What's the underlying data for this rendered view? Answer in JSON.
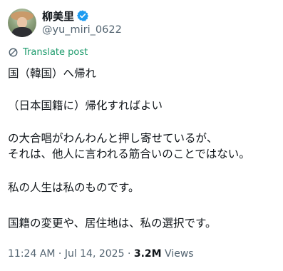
{
  "author": {
    "display_name": "柳美里",
    "handle": "@yu_miri_0622"
  },
  "translate_label": "Translate post",
  "post_lines": [
    "国（韓国）へ帰れ",
    "（日本国籍に）帰化すればよい",
    "の大合唱がわんわんと押し寄せているが、",
    "それは、他人に言われる筋合いのことではない。",
    "私の人生は私のものです。",
    "国籍の変更や、居住地は、私の選択です。"
  ],
  "meta": {
    "time": "11:24 AM",
    "separator": "·",
    "date": "Jul 14, 2025",
    "views_count": "3.2M",
    "views_label": "Views"
  },
  "colors": {
    "verified_badge": "#1d9bf0",
    "translate_link": "#1d9b6c",
    "secondary_text": "#536471"
  }
}
